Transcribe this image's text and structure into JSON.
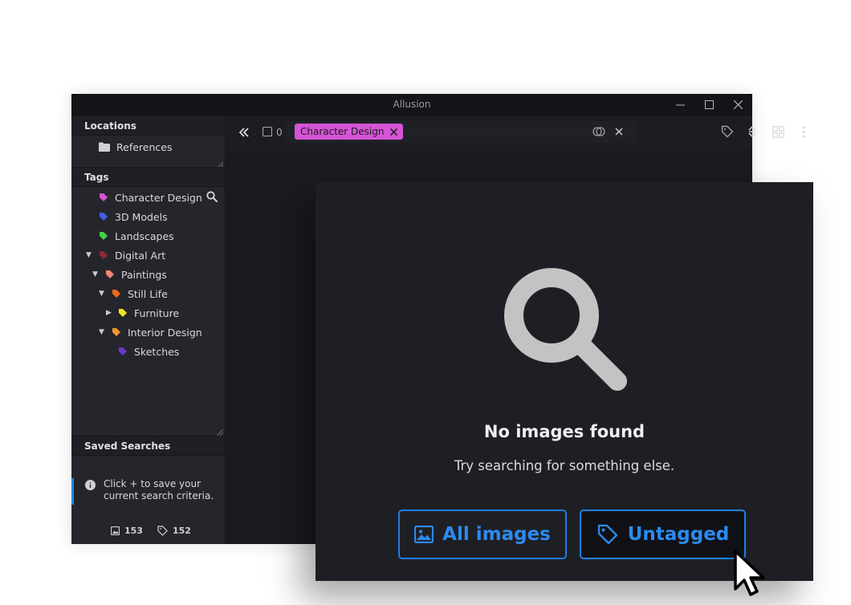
{
  "window": {
    "title": "Allusion"
  },
  "sidebar": {
    "locations_header": "Locations",
    "locations": [
      {
        "label": "References",
        "icon": "folder-icon"
      }
    ],
    "tags_header": "Tags",
    "tags": [
      {
        "label": "Character Design",
        "color": "#d654d6",
        "expanded": null
      },
      {
        "label": "3D Models",
        "color": "#3f5fe6",
        "expanded": null
      },
      {
        "label": "Landscapes",
        "color": "#43d14a",
        "expanded": null
      },
      {
        "label": "Digital Art",
        "color": "#8b2b33",
        "expanded": true
      },
      {
        "label": "Paintings",
        "color": "#f38474",
        "expanded": true
      },
      {
        "label": "Still Life",
        "color": "#f0681c",
        "expanded": true
      },
      {
        "label": "Furniture",
        "color": "#f1e229",
        "expanded": false
      },
      {
        "label": "Interior Design",
        "color": "#f3962a",
        "expanded": true
      },
      {
        "label": "Sketches",
        "color": "#6b35c4",
        "expanded": null
      }
    ],
    "saved_searches_header": "Saved Searches",
    "saved_hint": "Click + to save your current search criteria.",
    "stats": {
      "images": "153",
      "tags": "152"
    }
  },
  "toolbar": {
    "selection_count": "0",
    "search_chip": "Character Design"
  },
  "empty_state": {
    "heading": "No images found",
    "subheading": "Try searching for something else.",
    "all_images_label": "All images",
    "untagged_label": "Untagged"
  },
  "colors": {
    "accent": "#1e7fe0",
    "chip": "#d654d6",
    "window_bg": "#1c1d22"
  }
}
